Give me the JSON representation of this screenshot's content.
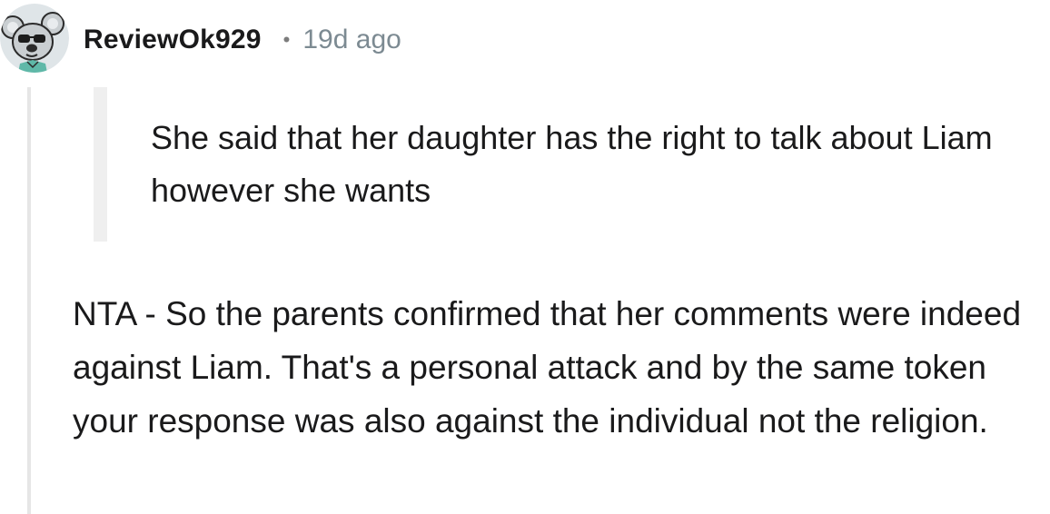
{
  "comment": {
    "author": "ReviewOk929",
    "separator": "•",
    "timestamp": "19d ago",
    "avatar_icon": "koala-with-sunglasses-avatar-icon",
    "quote": "She said that her daughter has the right to talk about Liam however she wants",
    "body": "NTA - So the parents confirmed that her comments were indeed against Liam. That's a personal attack and by the same token your response was also against the individual not the religion."
  },
  "colors": {
    "text": "#1a1a1b",
    "meta": "#7c8a92",
    "thread_line": "#e6e6e6",
    "quote_bar": "#efefef"
  }
}
